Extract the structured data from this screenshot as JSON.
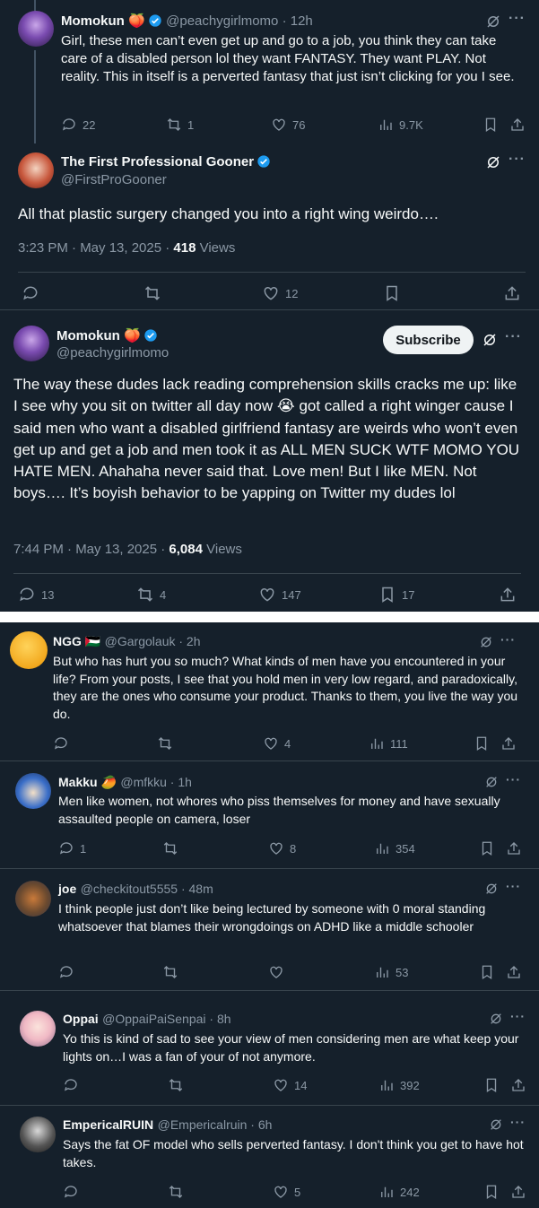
{
  "colors": {
    "background": "#15202b",
    "text": "#f7f9f9",
    "secondary": "#8b98a5",
    "verified": "#1d9bf0",
    "divider": "#38444d"
  },
  "posts": [
    {
      "name": "Momokun 🍑",
      "handle": "@peachygirlmomo · 12h",
      "text": "Girl, these men can’t even get up and go to a job, you think they can take care of a disabled person lol they want FANTASY. They want PLAY. Not reality. This in itself is a perverted fantasy that just isn’t clicking for you I see.",
      "replies": "22",
      "reposts": "1",
      "likes": "76",
      "views": "9.7K"
    },
    {
      "name": "The First Professional Gooner",
      "handle": "@FirstProGooner",
      "text": "All that plastic surgery changed you into a right wing weirdo….",
      "time": "3:23 PM · May 13, 2025 · ",
      "views_count": "418",
      "views_label": " Views",
      "likes": "12"
    },
    {
      "name": "Momokun 🍑",
      "handle": "@peachygirlmomo",
      "subscribe": "Subscribe",
      "text": "The way these dudes lack reading comprehension skills cracks me up: like I see why you sit on twitter all day now 😭 got called a right winger cause I said men who want a disabled girlfriend fantasy are weirds who won’t even get up and get a job and men took it as ALL MEN SUCK WTF MOMO YOU HATE MEN. Ahahaha never said that. Love men! But I like MEN. Not boys…. It’s boyish behavior to be yapping on Twitter my dudes lol",
      "time": "7:44 PM · May 13, 2025 · ",
      "views_count": "6,084",
      "views_label": " Views",
      "replies": "13",
      "reposts": "4",
      "likes": "147",
      "bookmarks": "17"
    },
    {
      "name": "NGG 🇵🇸",
      "handle": "@Gargolauk · 2h",
      "text": "But who has hurt you so much? What kinds of men have you encountered in your life? From your posts, I see that you hold men in very low regard, and paradoxically, they are the ones who consume your product. Thanks to them, you live the way you do.",
      "likes": "4",
      "views": "111"
    },
    {
      "name": "Makku 🥭",
      "handle": "@mfkku · 1h",
      "text": "Men like women, not whores who piss themselves for money and have sexually assaulted people on camera, loser",
      "replies": "1",
      "likes": "8",
      "views": "354"
    },
    {
      "name": "joe",
      "handle": "@checkitout5555 · 48m",
      "text": "I think people just don’t like being lectured by someone with 0 moral standing whatsoever that blames their wrongdoings on ADHD like a middle schooler",
      "views": "53"
    },
    {
      "name": "Oppai",
      "handle": "@OppaiPaiSenpai · 8h",
      "text": "Yo this is kind of sad to see your view of men considering men are what keep your lights on…I was a fan of your of not anymore.",
      "likes": "14",
      "views": "392"
    },
    {
      "name": "EmpericalRUIN",
      "handle": "@Empericalruin · 6h",
      "text": "Says the fat OF model who sells perverted fantasy. I don't think you get to have hot takes.",
      "likes": "5",
      "views": "242"
    }
  ]
}
